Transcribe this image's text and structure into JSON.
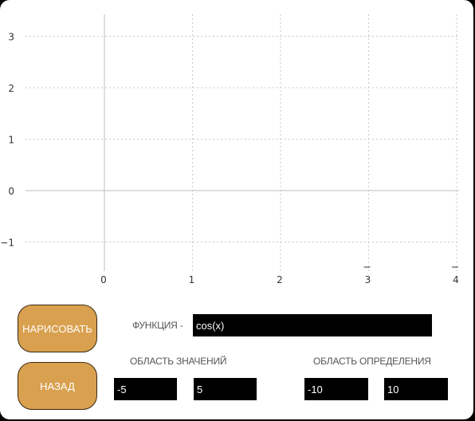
{
  "plot": {
    "x_ticks": [
      "0",
      "1",
      "2",
      "3",
      "4"
    ],
    "y_ticks": [
      "3",
      "2",
      "1",
      "0",
      "−1"
    ]
  },
  "controls": {
    "draw_label": "НАРИСОВАТЬ",
    "back_label": "НАЗАД",
    "function_label": "ФУНКЦИЯ -",
    "function_value": "cos(x)",
    "range_label": "ОБЛАСТЬ ЗНАЧЕНИЙ",
    "range_min": "-5",
    "range_max": "5",
    "domain_label": "ОБЛАСТЬ ОПРЕДЕЛЕНИЯ",
    "domain_min": "-10",
    "domain_max": "10"
  },
  "colors": {
    "button": "#d9a04f",
    "field_bg": "#000000",
    "field_text": "#ffffff",
    "grid": "#c8c8c8",
    "axis": "#bdbdbd"
  }
}
